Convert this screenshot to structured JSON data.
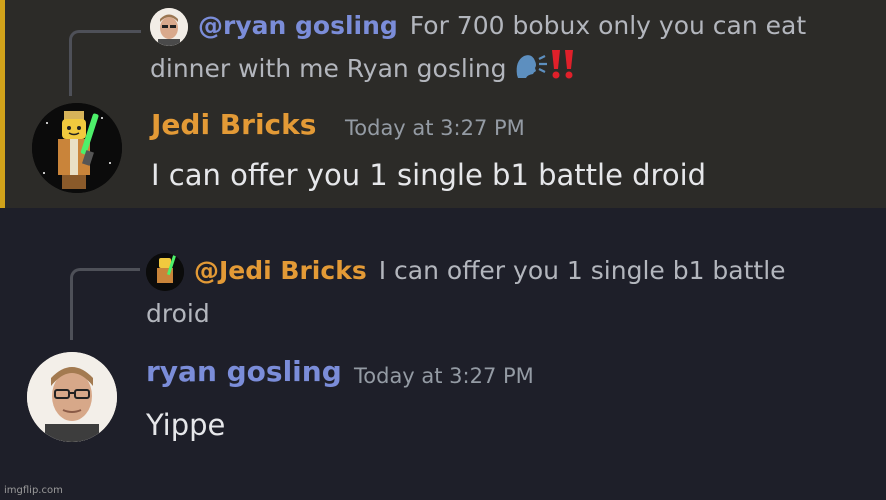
{
  "messages": [
    {
      "reply": {
        "mention": "@ryan gosling",
        "text": "For 700 bobux only you can eat dinner with me Ryan gosling",
        "emoji": [
          "speaking-head-emoji",
          "double-exclamation-emoji"
        ],
        "mention_color": "#7b8dd9"
      },
      "author": "Jedi Bricks",
      "author_color": "#e39a36",
      "timestamp": "Today at 3:27 PM",
      "content": "I can offer you 1 single b1 battle droid",
      "highlight_color": "#d1a21a"
    },
    {
      "reply": {
        "mention": "@Jedi Bricks",
        "text": "I can offer you 1 single b1 battle droid",
        "mention_color": "#e39a36"
      },
      "author": "ryan gosling",
      "author_color": "#7b8dd9",
      "timestamp": "Today at 3:27 PM",
      "content": "Yippe"
    }
  ],
  "watermark": "imgflip.com"
}
